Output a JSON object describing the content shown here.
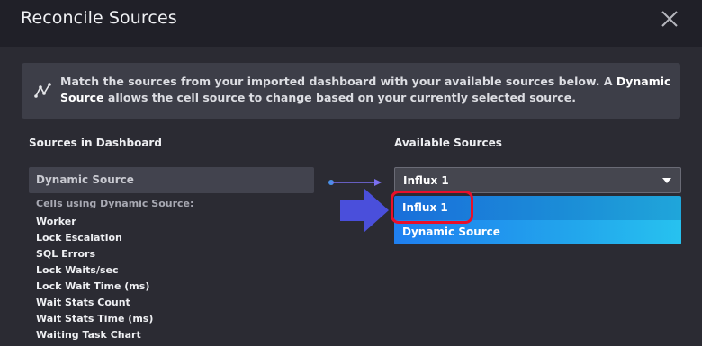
{
  "dialog": {
    "title": "Reconcile Sources",
    "close_icon": "close-icon"
  },
  "info": {
    "icon": "dynamic-source-icon",
    "text_before": "Match the sources from your imported dashboard with your available sources below. A ",
    "text_bold": "Dynamic Source",
    "text_after": " allows the cell source to change based on your currently selected source."
  },
  "left_column": {
    "header": "Sources in Dashboard",
    "source_name": "Dynamic Source",
    "cells_header": "Cells using Dynamic Source:",
    "cells": [
      "Worker",
      "Lock Escalation",
      "SQL Errors",
      "Lock Waits/sec",
      "Lock Wait Time (ms)",
      "Wait Stats Count",
      "Wait Stats Time (ms)",
      "Waiting Task Chart"
    ]
  },
  "right_column": {
    "header": "Available Sources",
    "selected": "Influx 1",
    "options": [
      "Influx 1",
      "Dynamic Source"
    ]
  },
  "colors": {
    "accent": "#22a4ec",
    "highlight": "#e8102a",
    "arrow": "#4a4fdb",
    "connector": "#7b6ff0"
  }
}
